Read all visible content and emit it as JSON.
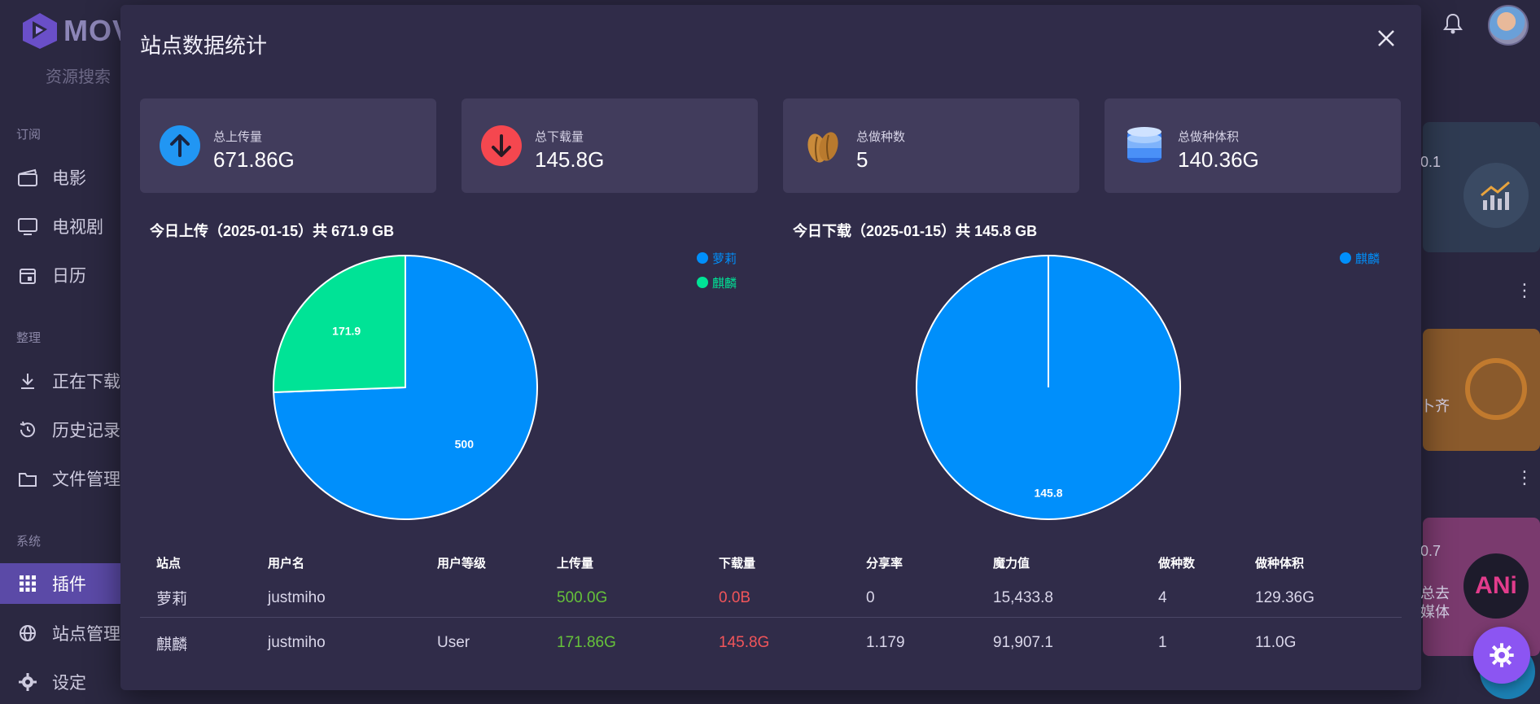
{
  "app": {
    "logo_text": "MOV"
  },
  "sidebar": {
    "partial_top_item": "资源搜索",
    "sections": [
      {
        "title": "订阅",
        "items": [
          {
            "label": "电影",
            "icon": "clapperboard-icon"
          },
          {
            "label": "电视剧",
            "icon": "monitor-icon"
          },
          {
            "label": "日历",
            "icon": "calendar-icon"
          }
        ]
      },
      {
        "title": "整理",
        "items": [
          {
            "label": "正在下载",
            "icon": "download-icon"
          },
          {
            "label": "历史记录",
            "icon": "history-icon"
          },
          {
            "label": "文件管理",
            "icon": "folder-icon"
          }
        ]
      },
      {
        "title": "系统",
        "items": [
          {
            "label": "插件",
            "icon": "grid-icon",
            "active": true
          },
          {
            "label": "站点管理",
            "icon": "globe-icon"
          },
          {
            "label": "设定",
            "icon": "gear-icon"
          }
        ]
      }
    ]
  },
  "background_cards": {
    "c1_text": "0.1",
    "c2_text": "卜齐",
    "c3_text_a": "0.7",
    "c3_text_b": "总去",
    "c3_text_c": "媒体"
  },
  "modal": {
    "title": "站点数据统计",
    "stats": [
      {
        "label": "总上传量",
        "value": "671.86G",
        "icon": "arrow-up-icon"
      },
      {
        "label": "总下载量",
        "value": "145.8G",
        "icon": "arrow-down-icon"
      },
      {
        "label": "总做种数",
        "value": "5",
        "icon": "seed-icon"
      },
      {
        "label": "总做种体积",
        "value": "140.36G",
        "icon": "database-icon"
      }
    ]
  },
  "chart_data": [
    {
      "type": "pie",
      "title": "今日上传（2025-01-15）共 671.9 GB",
      "categories": [
        "萝莉",
        "麒麟"
      ],
      "values": [
        500,
        171.9
      ],
      "labels": [
        "500",
        "171.9"
      ],
      "colors": [
        "#008ffb",
        "#00e396"
      ],
      "legend": "top-right"
    },
    {
      "type": "pie",
      "title": "今日下载（2025-01-15）共 145.8 GB",
      "categories": [
        "麒麟"
      ],
      "values": [
        145.8
      ],
      "labels": [
        "145.8"
      ],
      "colors": [
        "#008ffb"
      ],
      "legend": "top-right"
    }
  ],
  "table": {
    "headers": [
      "站点",
      "用户名",
      "用户等级",
      "上传量",
      "下载量",
      "分享率",
      "魔力值",
      "做种数",
      "做种体积"
    ],
    "rows": [
      [
        "萝莉",
        "justmiho",
        "",
        "500.0G",
        "0.0B",
        "0",
        "15,433.8",
        "4",
        "129.36G"
      ],
      [
        "麒麟",
        "justmiho",
        "User",
        "171.86G",
        "145.8G",
        "1.179",
        "91,907.1",
        "1",
        "11.0G"
      ]
    ]
  }
}
